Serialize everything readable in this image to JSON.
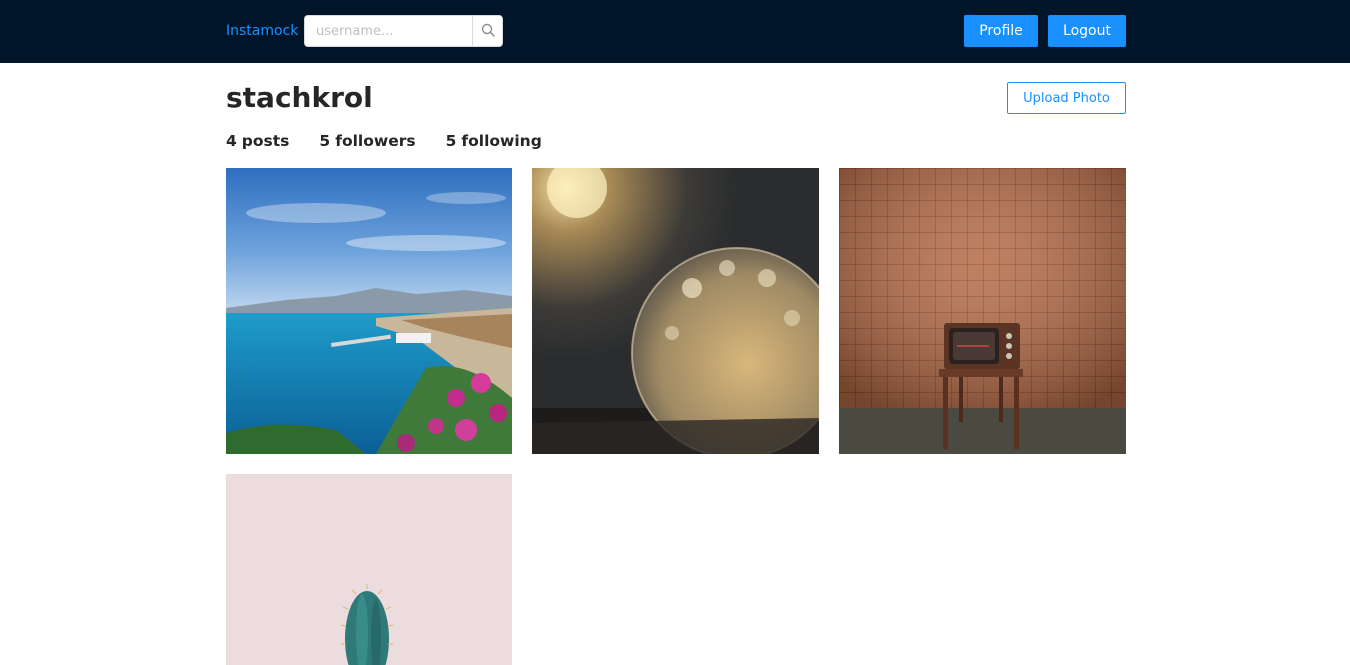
{
  "nav": {
    "brand": "Instamock",
    "search_placeholder": "username...",
    "search_icon": "search-icon",
    "profile_label": "Profile",
    "logout_label": "Logout"
  },
  "profile": {
    "username": "stachkrol",
    "upload_label": "Upload Photo",
    "stats": {
      "posts_count": "4",
      "posts_label": "posts",
      "followers_count": "5",
      "followers_label": "followers",
      "following_count": "5",
      "following_label": "following"
    }
  },
  "photos": [
    {
      "subject": "coastal bay with flowers"
    },
    {
      "subject": "frozen bubble at sunset"
    },
    {
      "subject": "vintage tv on stool"
    },
    {
      "subject": "cactus on pink background"
    }
  ],
  "colors": {
    "navbar_bg": "#001529",
    "primary": "#1890ff",
    "text": "#262626"
  }
}
